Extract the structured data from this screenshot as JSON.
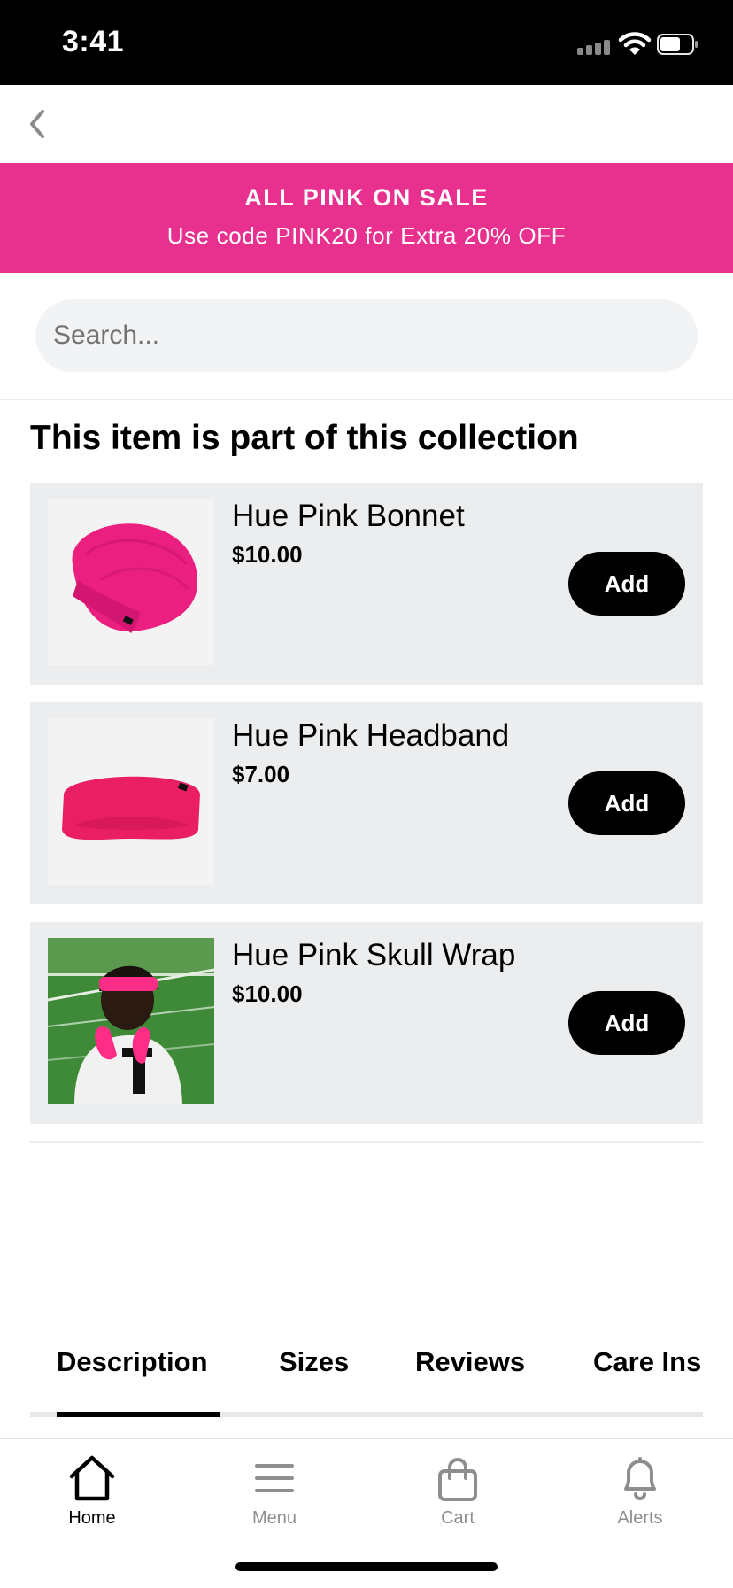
{
  "status_bar": {
    "time": "3:41"
  },
  "promo": {
    "title": "ALL PINK ON SALE",
    "subtitle": "Use code PINK20 for Extra 20% OFF",
    "color": "#e8318f"
  },
  "search": {
    "placeholder": "Search..."
  },
  "collection": {
    "title": "This item is part of this collection",
    "items": [
      {
        "name": "Hue Pink Bonnet",
        "price": "$10.00",
        "add_label": "Add"
      },
      {
        "name": "Hue Pink Headband",
        "price": "$7.00",
        "add_label": "Add"
      },
      {
        "name": "Hue Pink Skull Wrap",
        "price": "$10.00",
        "add_label": "Add"
      }
    ]
  },
  "tabs": {
    "items": [
      "Description",
      "Sizes",
      "Reviews",
      "Care Ins"
    ],
    "active": "Description"
  },
  "bottom_nav": {
    "items": [
      {
        "label": "Home",
        "icon": "home-icon",
        "active": true
      },
      {
        "label": "Menu",
        "icon": "menu-icon",
        "active": false
      },
      {
        "label": "Cart",
        "icon": "cart-icon",
        "active": false
      },
      {
        "label": "Alerts",
        "icon": "bell-icon",
        "active": false
      }
    ]
  }
}
